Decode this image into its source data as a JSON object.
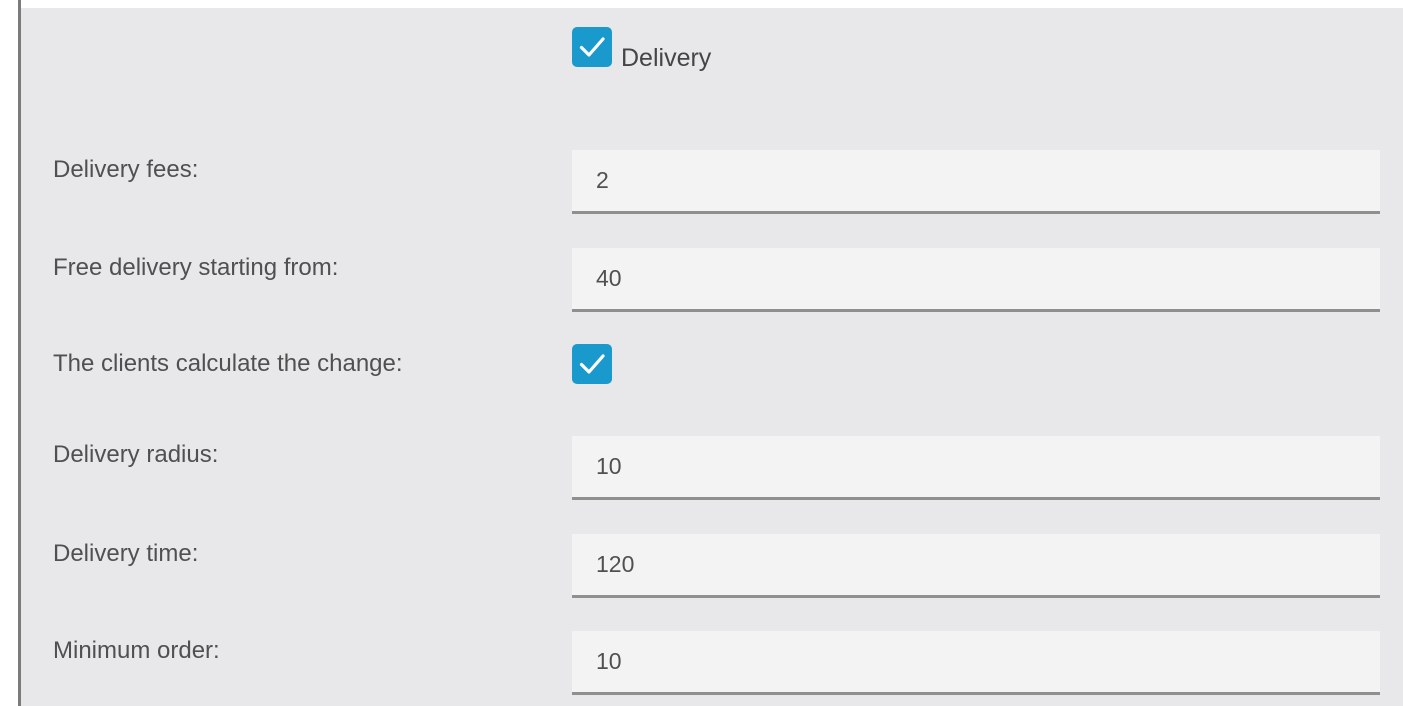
{
  "delivery": {
    "label": "Delivery",
    "checked": true
  },
  "fields": {
    "delivery_fees": {
      "label": "Delivery fees:",
      "value": "2"
    },
    "free_delivery": {
      "label": "Free delivery starting from:",
      "value": "40"
    },
    "clients_calculate_change": {
      "label": "The clients calculate the change:",
      "checked": true
    },
    "delivery_radius": {
      "label": "Delivery radius:",
      "value": "10"
    },
    "delivery_time": {
      "label": "Delivery time:",
      "value": "120"
    },
    "minimum_order": {
      "label": "Minimum order:",
      "value": "10"
    }
  },
  "colors": {
    "panel_background": "#e8e8ea",
    "checkbox_accent": "#1a99cc",
    "input_background": "#f3f3f4",
    "input_underline": "#8f8f8f",
    "text": "#505050"
  },
  "icons": {
    "checkmark": "check-icon"
  }
}
